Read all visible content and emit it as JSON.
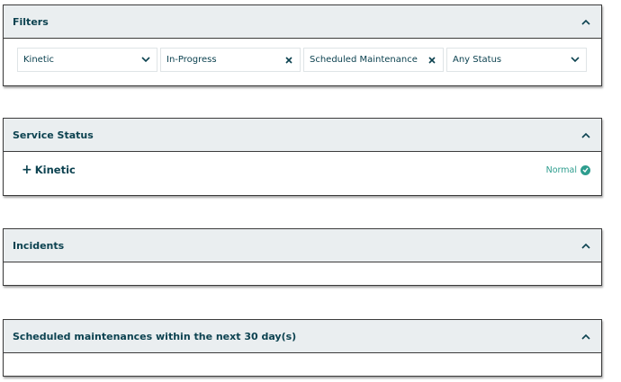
{
  "filters": {
    "title": "Filters",
    "items": [
      {
        "label": "Kinetic",
        "icon": "chevron-down-icon"
      },
      {
        "label": "In-Progress",
        "icon": "close-icon"
      },
      {
        "label": "Scheduled Maintenance",
        "icon": "close-icon"
      },
      {
        "label": "Any Status",
        "icon": "chevron-down-icon"
      }
    ]
  },
  "service_status": {
    "title": "Service Status",
    "services": [
      {
        "name": "Kinetic",
        "status": "Normal"
      }
    ]
  },
  "incidents": {
    "title": "Incidents"
  },
  "scheduled": {
    "title": "Scheduled maintenances within the next 30 day(s)"
  },
  "colors": {
    "text": "#0c4250",
    "header_bg": "#eaeef0",
    "status_ok": "#2e9d8e",
    "border": "#3b3b3b"
  }
}
